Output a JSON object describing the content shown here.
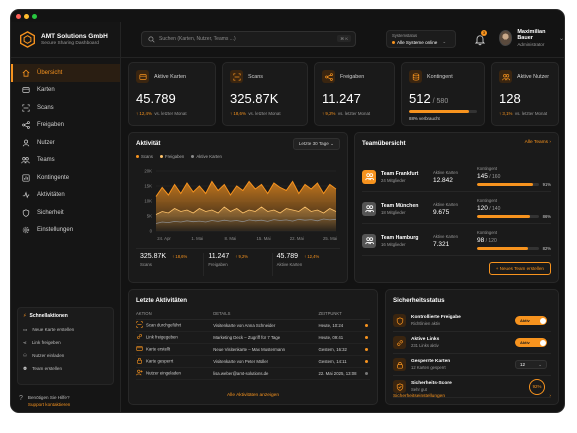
{
  "colors": {
    "accent": "#f7931e",
    "background": "#131313",
    "card": "#1a1a1a"
  },
  "window_dots": [
    "#ff5f57",
    "#febc2e",
    "#28c840"
  ],
  "brand": {
    "title": "AMT Solutions GmbH",
    "subtitle": "Secure Sharing Dashboard",
    "icon": "hexagon-logo-icon"
  },
  "nav": [
    {
      "label": "Übersicht",
      "icon": "home-icon",
      "active": true
    },
    {
      "label": "Karten",
      "icon": "card-icon"
    },
    {
      "label": "Scans",
      "icon": "scan-icon"
    },
    {
      "label": "Freigaben",
      "icon": "share-icon"
    },
    {
      "label": "Nutzer",
      "icon": "user-icon"
    },
    {
      "label": "Teams",
      "icon": "team-icon"
    },
    {
      "label": "Kontingente",
      "icon": "quota-icon"
    },
    {
      "label": "Aktivitäten",
      "icon": "activity-icon"
    },
    {
      "label": "Sicherheit",
      "icon": "shield-icon"
    },
    {
      "label": "Einstellungen",
      "icon": "gear-icon"
    }
  ],
  "shortcuts": {
    "title": "Schnellaktionen",
    "items": [
      "Neue Karte erstellen",
      "Link freigeben",
      "Nutzer einladen",
      "Team erstellen"
    ]
  },
  "help": {
    "text": "Benötigen Sie Hilfe?",
    "link": "Support kontaktieren"
  },
  "search": {
    "placeholder": "Suchen (Karten, Nutzer, Teams ...)",
    "shortcut": "⌘ K"
  },
  "system_status": {
    "label": "Systemstatus",
    "value": "Alle Systeme online"
  },
  "notifications": {
    "count": "3"
  },
  "user": {
    "name": "Maximilian Bauer",
    "role": "Administrator"
  },
  "kpis": [
    {
      "label": "Aktive Karten",
      "icon": "card-icon",
      "value": "45.789",
      "change": "12,4%",
      "note": "vs. letzter Monat"
    },
    {
      "label": "Scans",
      "icon": "scan-icon",
      "value": "325.87K",
      "change": "18,6%",
      "note": "vs. letzter Monat"
    },
    {
      "label": "Freigaben",
      "icon": "share-icon",
      "value": "11.247",
      "change": "9,2%",
      "note": "vs. letzter Monat"
    },
    {
      "label": "Kontingent",
      "icon": "database-icon",
      "value": "512",
      "sub": " / 580",
      "note": "88% verbraucht",
      "progress": 0.88
    },
    {
      "label": "Aktive Nutzer",
      "icon": "users-icon",
      "value": "128",
      "change": "3,1%",
      "note": "vs. letzter Monat"
    }
  ],
  "activity": {
    "title": "Aktivität",
    "range": "Letzte 30 Tage",
    "legend": [
      "Scans",
      "Freigaben",
      "Aktive Karten"
    ],
    "stats": [
      {
        "value": "325.87K",
        "change": "18,6%",
        "label": "Scans"
      },
      {
        "value": "11.247",
        "change": "9,2%",
        "label": "Freigaben"
      },
      {
        "value": "45.789",
        "change": "12,4%",
        "label": "Aktive Karten"
      }
    ]
  },
  "chart_data": {
    "type": "area",
    "x": [
      "24. Apr",
      "1. Mai",
      "8. Mai",
      "15. Mai",
      "22. Mai",
      "25. Mai"
    ],
    "yticks": [
      "20K",
      "15K",
      "10K",
      "5K",
      "0"
    ],
    "ylim": [
      0,
      20000
    ],
    "series": [
      {
        "name": "Scans",
        "color": "#f7931e",
        "values": [
          11500,
          14500,
          12000,
          15500,
          12500,
          16000,
          13000,
          15000,
          12500,
          16500,
          13500,
          15500,
          12000,
          15000,
          13500,
          16500,
          14000,
          15500,
          12500,
          16000,
          14500,
          13500,
          16500,
          12500,
          15500,
          14000,
          16000,
          12500,
          15500,
          14000
        ]
      },
      {
        "name": "Freigaben",
        "color": "#ffc36b",
        "values": [
          5500,
          6500,
          6000,
          7500,
          6500,
          7000,
          6000,
          7500,
          6500,
          7000,
          6000,
          8000,
          6500,
          7500,
          6000,
          7000,
          6500,
          8000,
          6500,
          7000,
          6000,
          7500,
          7000,
          6500,
          8000,
          6500,
          7000,
          6000,
          7500,
          6500
        ]
      },
      {
        "name": "Aktive Karten",
        "color": "#8a8a8a",
        "values": [
          2500,
          3000,
          2800,
          3200,
          3000,
          3400,
          3100,
          3300,
          3000,
          3500,
          3200,
          3600,
          3300,
          3500,
          3100,
          3700,
          3400,
          3600,
          3200,
          3800,
          3500,
          3700,
          3300,
          3900,
          3600,
          3800,
          3400,
          4000,
          3700,
          3900
        ]
      }
    ]
  },
  "teams": {
    "title": "Teamübersicht",
    "link": "Alle Teams",
    "col_cards": "Aktive Karten",
    "col_quota": "Kontingent",
    "items": [
      {
        "name": "Team Frankfurt",
        "members": "24 Mitglieder",
        "cards": "12.842",
        "quota": "145",
        "quota_total": " / 160",
        "pct": "91%",
        "fill": 0.91,
        "color": "#f7931e"
      },
      {
        "name": "Team München",
        "members": "18 Mitglieder",
        "cards": "9.675",
        "quota": "120",
        "quota_total": " / 140",
        "pct": "86%",
        "fill": 0.86,
        "color": "#555555"
      },
      {
        "name": "Team Hamburg",
        "members": "16 Mitglieder",
        "cards": "7.321",
        "quota": "98",
        "quota_total": " / 120",
        "pct": "82%",
        "fill": 0.82,
        "color": "#555555"
      }
    ],
    "button": "+ Neues Team erstellen"
  },
  "recent": {
    "title": "Letzte Aktivitäten",
    "headers": [
      "AKTION",
      "DETAILS",
      "ZEITPUNKT"
    ],
    "rows": [
      {
        "icon": "scan-icon",
        "action": "Scan durchgeführt",
        "details": "Visitenkarte von Anna Schneider",
        "time": "Heute, 10:24",
        "status": "#f7931e"
      },
      {
        "icon": "link-icon",
        "action": "Link freigegeben",
        "details": "Marketing Deck – Zugriff für 7 Tage",
        "time": "Heute, 09:41",
        "status": "#f7931e"
      },
      {
        "icon": "card-icon",
        "action": "Karte erstellt",
        "details": "Neue Visitenkarte – Max Mustermann",
        "time": "Gestern, 16:32",
        "status": "#f7931e"
      },
      {
        "icon": "lock-icon",
        "action": "Karte gesperrt",
        "details": "Visitenkarte von Peter Müller",
        "time": "Gestern, 14:11",
        "status": "#f7931e"
      },
      {
        "icon": "user-plus-icon",
        "action": "Nutzer eingeladen",
        "details": "lisa.weber@amt-solutions.de",
        "time": "22. Mai 2025, 13:08",
        "status": "#777777"
      }
    ],
    "link": "Alle Aktivitäten anzeigen"
  },
  "security": {
    "title": "Sicherheitsstatus",
    "items": [
      {
        "title": "Kontrollierte Freigabe",
        "sub": "Richtlinien aktiv",
        "control": "toggle",
        "value": "Aktiv",
        "icon": "shield-icon"
      },
      {
        "title": "Aktive Links",
        "sub": "231 Links aktiv",
        "control": "toggle",
        "value": "Aktiv",
        "icon": "link-icon"
      },
      {
        "title": "Gesperrte Karten",
        "sub": "12 Karten gesperrt",
        "control": "stepper",
        "value": "12",
        "icon": "lock-icon"
      },
      {
        "title": "Sicherheits-Score",
        "sub": "Sehr gut",
        "control": "ring",
        "value": "92%",
        "icon": "shield-check-icon"
      }
    ],
    "link": "Sicherheitseinstellungen"
  }
}
